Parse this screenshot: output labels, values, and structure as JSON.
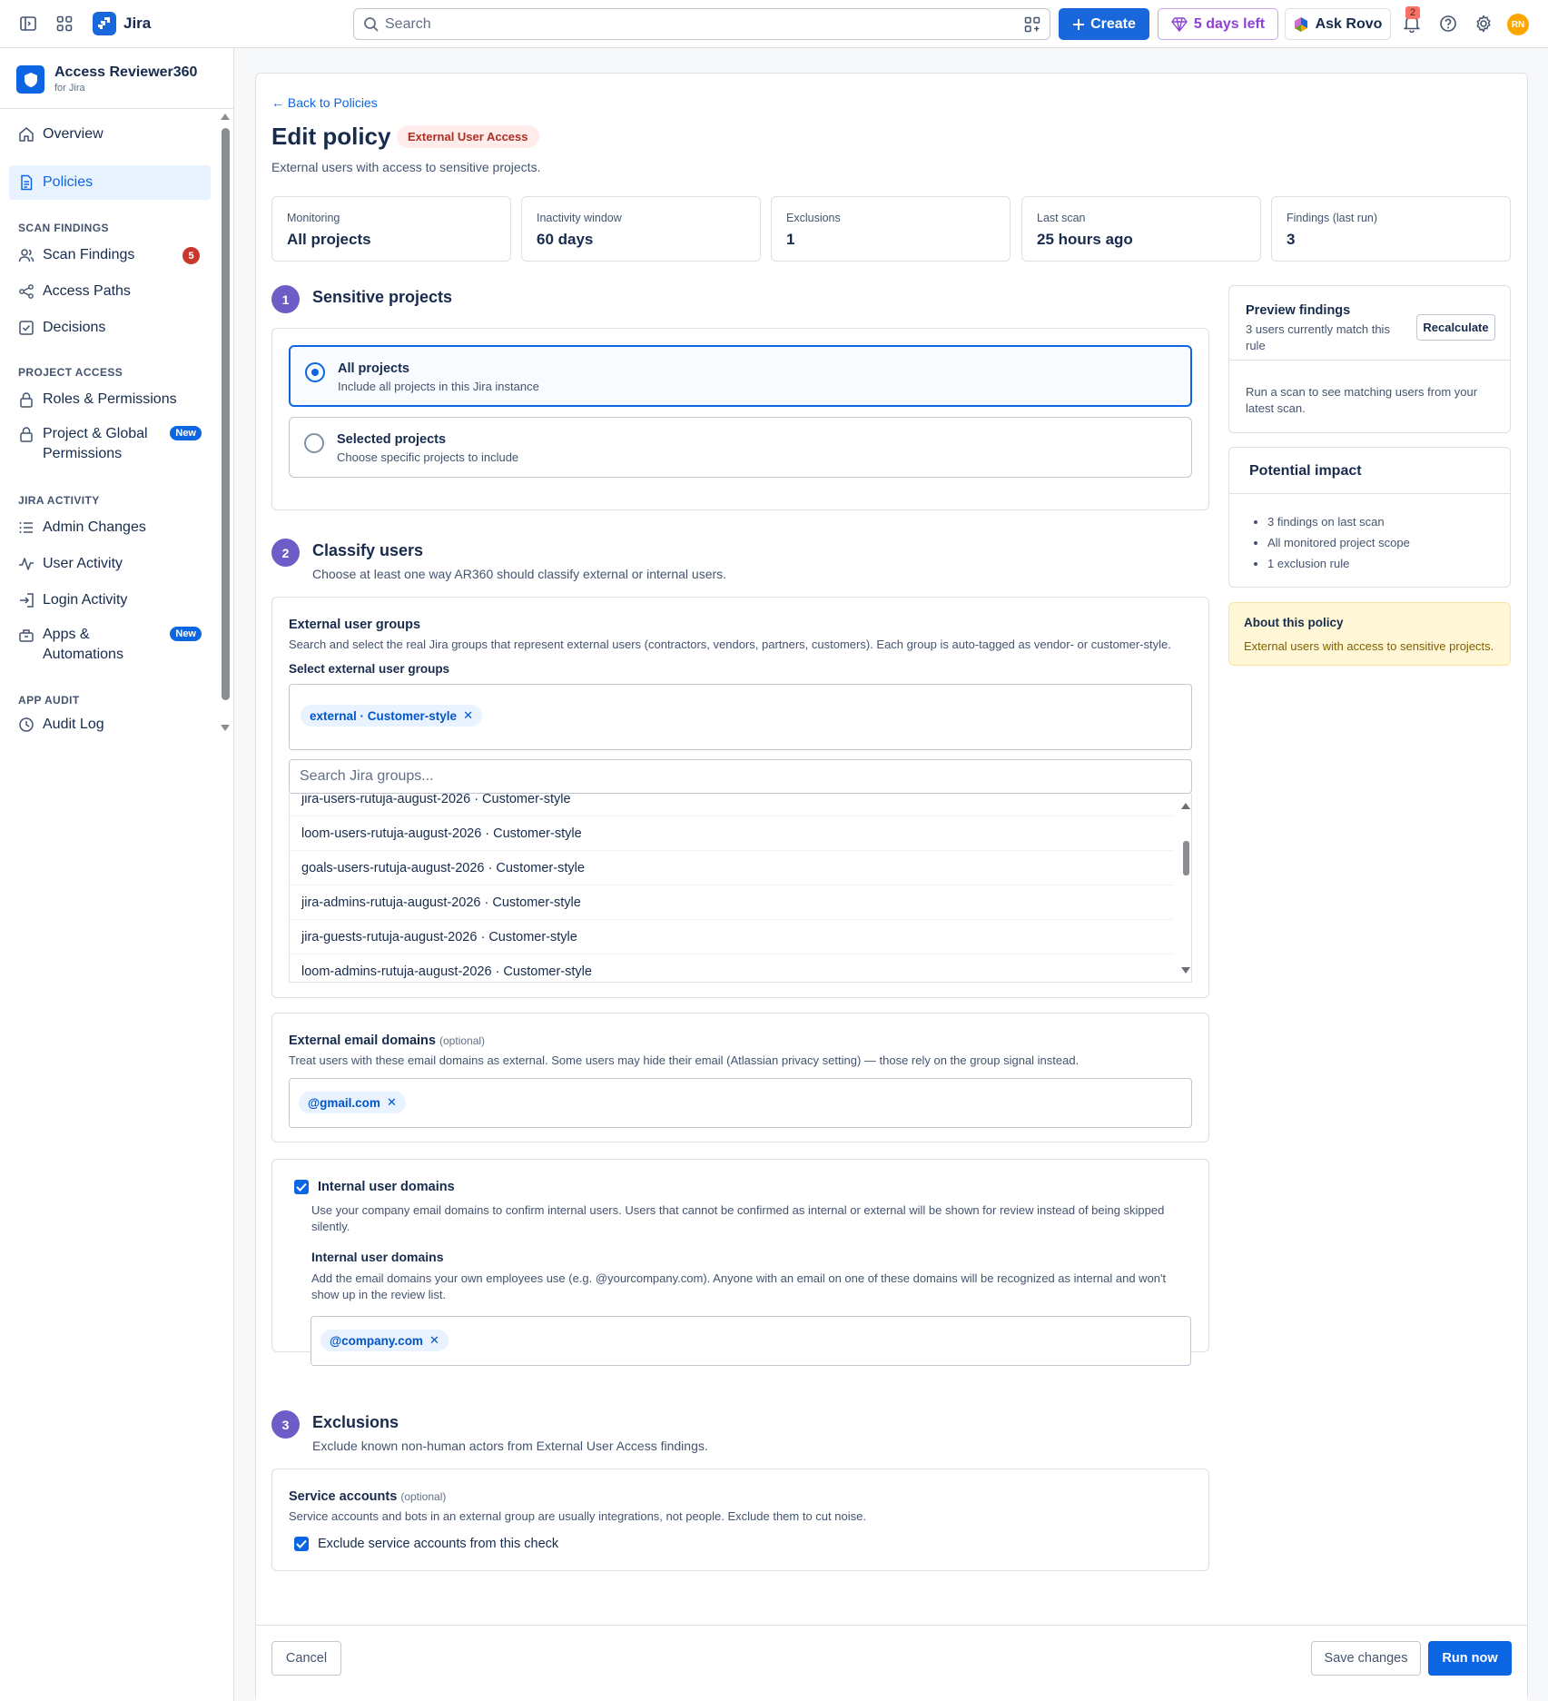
{
  "topbar": {
    "product": "Jira",
    "search_placeholder": "Search",
    "create_label": "Create",
    "trial_label": "5 days left",
    "rovo_label": "Ask Rovo",
    "notification_count": "2",
    "avatar_initials": "RN"
  },
  "sidebar": {
    "app_name": "Access Reviewer360",
    "app_sub": "for Jira",
    "overview": "Overview",
    "policies": "Policies",
    "sec_scan": "SCAN FINDINGS",
    "scan_findings": "Scan Findings",
    "scan_findings_count": "5",
    "access_paths": "Access Paths",
    "decisions": "Decisions",
    "sec_project": "PROJECT ACCESS",
    "roles": "Roles & Permissions",
    "project_global": "Project & Global Permissions",
    "new_label": "New",
    "sec_activity": "JIRA ACTIVITY",
    "admin_changes": "Admin Changes",
    "user_activity": "User Activity",
    "login_activity": "Login Activity",
    "apps": "Apps & Automations",
    "sec_audit": "APP AUDIT",
    "audit_log": "Audit Log"
  },
  "page": {
    "back": "← Back to Policies",
    "title": "Edit policy",
    "lozenge": "External User Access",
    "description": "External users with access to sensitive projects."
  },
  "stats": [
    {
      "label": "Monitoring",
      "value": "All projects"
    },
    {
      "label": "Inactivity window",
      "value": "60 days"
    },
    {
      "label": "Exclusions",
      "value": "1"
    },
    {
      "label": "Last scan",
      "value": "25 hours ago"
    },
    {
      "label": "Findings (last run)",
      "value": "3"
    }
  ],
  "step1": {
    "num": "1",
    "title": "Sensitive projects",
    "opt_all_title": "All projects",
    "opt_all_sub": "Include all projects in this Jira instance",
    "opt_sel_title": "Selected projects",
    "opt_sel_sub": "Choose specific projects to include"
  },
  "step2": {
    "num": "2",
    "title": "Classify users",
    "subtitle": "Choose at least one way AR360 should classify external or internal users.",
    "groups_title": "External user groups",
    "groups_help": "Search and select the real Jira groups that represent external users (contractors, vendors, partners, customers). Each group is auto-tagged as vendor- or customer-style.",
    "groups_select_label": "Select external user groups",
    "groups_chip": "external · Customer-style",
    "groups_search_placeholder": "Search Jira groups...",
    "group_options": [
      "jira-users-rutuja-august-2026 · Customer-style",
      "loom-users-rutuja-august-2026 · Customer-style",
      "goals-users-rutuja-august-2026 · Customer-style",
      "jira-admins-rutuja-august-2026 · Customer-style",
      "jira-guests-rutuja-august-2026 · Customer-style",
      "loom-admins-rutuja-august-2026 · Customer-style"
    ],
    "email_title": "External email domains",
    "optional": "(optional)",
    "email_help": "Treat users with these email domains as external. Some users may hide their email (Atlassian privacy setting) — those rely on the group signal instead.",
    "email_chip": "@gmail.com",
    "internal_check_label": "Internal user domains",
    "internal_help1": "Use your company email domains to confirm internal users. Users that cannot be confirmed as internal or external will be shown for review instead of being skipped silently.",
    "internal_title": "Internal user domains",
    "internal_help2": "Add the email domains your own employees use (e.g. @yourcompany.com). Anyone with an email on one of these domains will be recognized as internal and won't show up in the review list.",
    "internal_chip": "@company.com"
  },
  "step3": {
    "num": "3",
    "title": "Exclusions",
    "subtitle": "Exclude known non-human actors from External User Access findings.",
    "svc_title": "Service accounts",
    "svc_optional": "(optional)",
    "svc_help": "Service accounts and bots in an external group are usually integrations, not people. Exclude them to cut noise.",
    "svc_check_label": "Exclude service accounts from this check"
  },
  "preview": {
    "title": "Preview findings",
    "sub": "3 users currently match this rule",
    "recalc": "Recalculate",
    "note": "Run a scan to see matching users from your latest scan."
  },
  "impact": {
    "title": "Potential impact",
    "items": [
      "3 findings on last scan",
      "All monitored project scope",
      "1 exclusion rule"
    ]
  },
  "about": {
    "title": "About this policy",
    "text": "External users with access to sensitive projects."
  },
  "footer": {
    "cancel": "Cancel",
    "save": "Save changes",
    "run": "Run now"
  },
  "colors": {
    "brand": "#0c66e4",
    "step": "#6e5dc6",
    "lozenge_bg": "#ffeceb",
    "lozenge_text": "#ae2e24",
    "about_bg": "#fff7d6"
  }
}
